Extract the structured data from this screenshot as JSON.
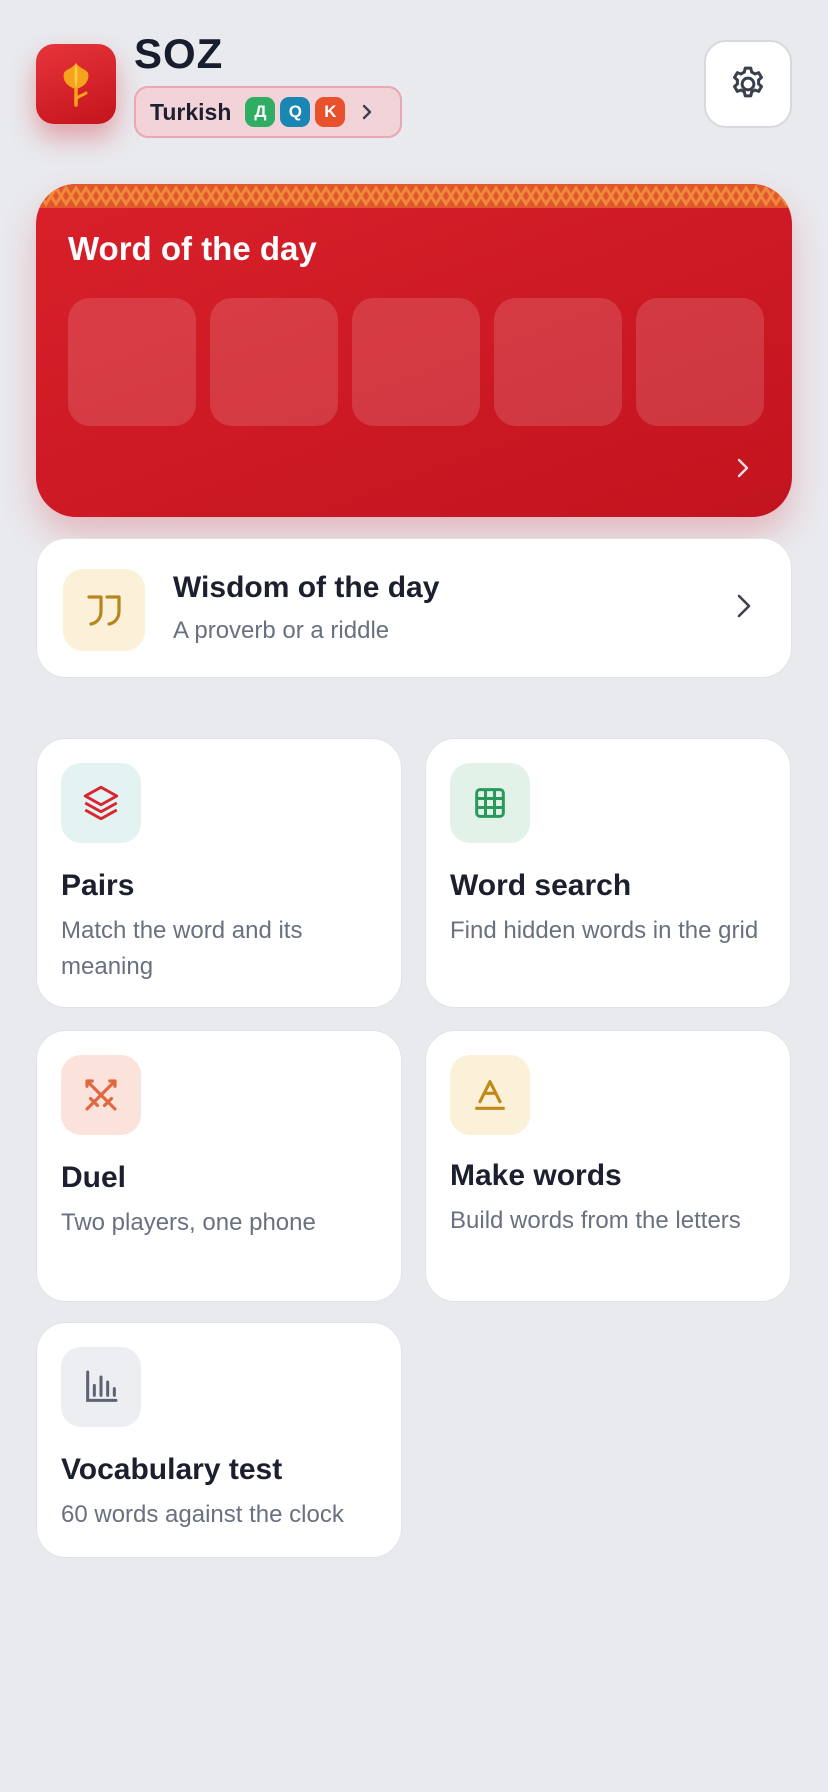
{
  "header": {
    "app_name": "SOZ",
    "language": {
      "name": "Turkish",
      "badges": [
        {
          "letter": "Д",
          "color": "#2fae63"
        },
        {
          "letter": "Q",
          "color": "#1a86b4"
        },
        {
          "letter": "K",
          "color": "#e8512c"
        }
      ]
    },
    "settings_icon": "gear-icon",
    "logo_icon": "tulip-icon"
  },
  "word_of_the_day": {
    "title": "Word of the day",
    "tile_count": 5,
    "color": "#d11a24"
  },
  "wisdom": {
    "title": "Wisdom of the day",
    "subtitle": "A proverb or a riddle",
    "icon": "quote-icon"
  },
  "games": [
    {
      "id": "pairs",
      "title": "Pairs",
      "description": "Match the word and its meaning",
      "icon": "layers-icon",
      "icon_bg": "#e3f3f2",
      "icon_color": "#d9252f"
    },
    {
      "id": "word-search",
      "title": "Word search",
      "description": "Find hidden words in the grid",
      "icon": "grid-icon",
      "icon_bg": "#e2f2e8",
      "icon_color": "#2a9a5a"
    },
    {
      "id": "duel",
      "title": "Duel",
      "description": "Two players, one phone",
      "icon": "swords-icon",
      "icon_bg": "#fbe3dc",
      "icon_color": "#e0673f"
    },
    {
      "id": "make-words",
      "title": "Make words",
      "description": "Build words from the letters",
      "icon": "letter-a-icon",
      "icon_bg": "#fbf1d9",
      "icon_color": "#c0891b"
    },
    {
      "id": "vocab-test",
      "title": "Vocabulary test",
      "description": "60 words against the clock",
      "icon": "bar-chart-icon",
      "icon_bg": "#eceef1",
      "icon_color": "#5b6272"
    }
  ]
}
